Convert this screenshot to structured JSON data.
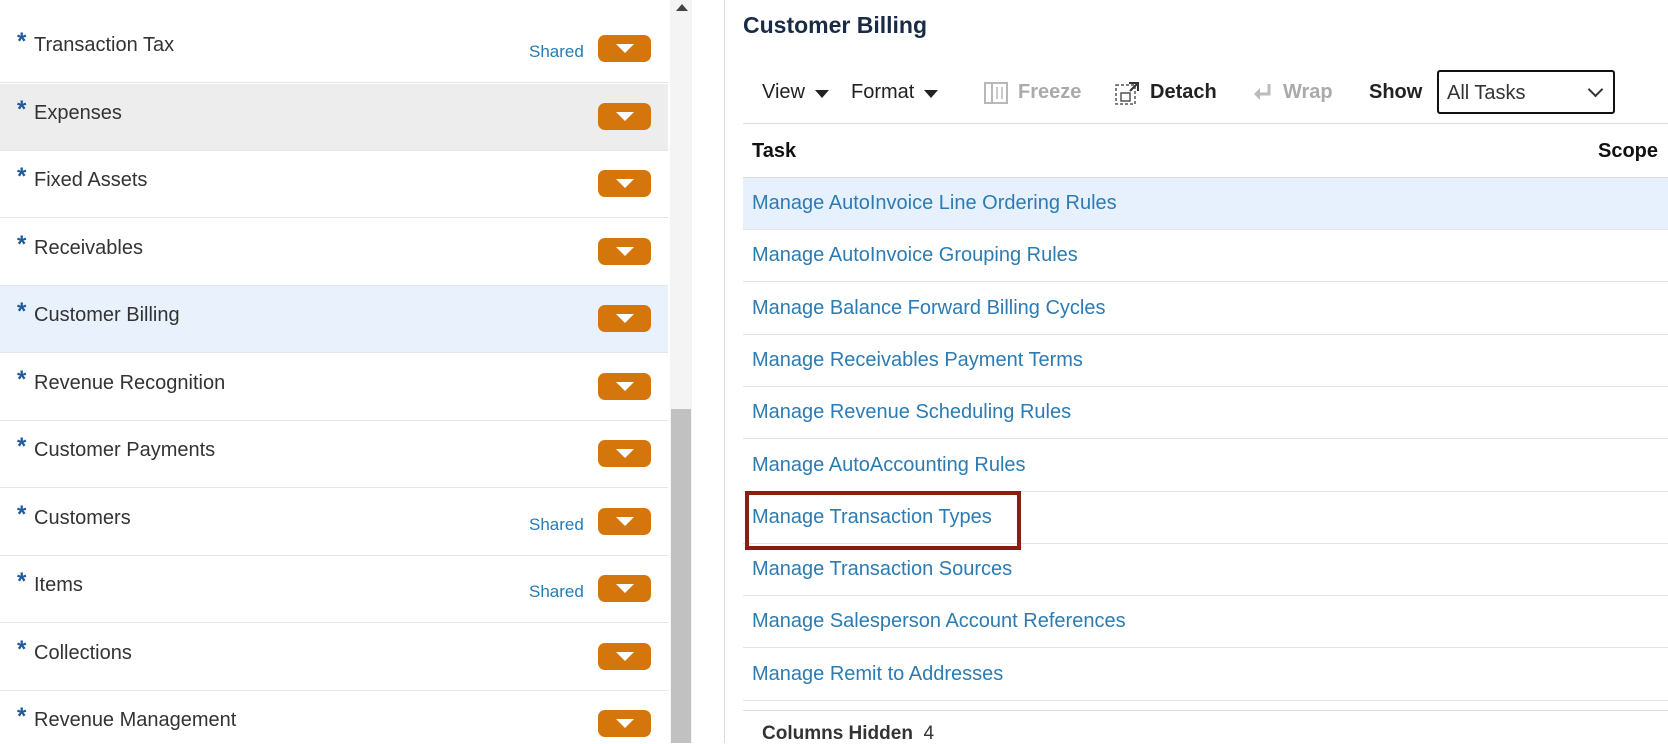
{
  "left_panel": {
    "items": [
      {
        "label": "Transaction Tax",
        "shared": "Shared",
        "state": ""
      },
      {
        "label": "Expenses",
        "shared": "",
        "state": "hover"
      },
      {
        "label": "Fixed Assets",
        "shared": "",
        "state": ""
      },
      {
        "label": "Receivables",
        "shared": "",
        "state": ""
      },
      {
        "label": "Customer Billing",
        "shared": "",
        "state": "selected"
      },
      {
        "label": "Revenue Recognition",
        "shared": "",
        "state": ""
      },
      {
        "label": "Customer Payments",
        "shared": "",
        "state": ""
      },
      {
        "label": "Customers",
        "shared": "Shared",
        "state": ""
      },
      {
        "label": "Items",
        "shared": "Shared",
        "state": ""
      },
      {
        "label": "Collections",
        "shared": "",
        "state": ""
      },
      {
        "label": "Revenue Management",
        "shared": "",
        "state": ""
      }
    ],
    "required_marker": "*"
  },
  "main": {
    "title": "Customer Billing",
    "toolbar": {
      "view_label": "View",
      "format_label": "Format",
      "freeze_label": "Freeze",
      "detach_label": "Detach",
      "wrap_label": "Wrap",
      "show_label": "Show",
      "show_value": "All Tasks"
    },
    "table": {
      "headers": {
        "task": "Task",
        "scope": "Scope"
      },
      "rows": [
        {
          "task": "Manage AutoInvoice Line Ordering Rules",
          "selected": true
        },
        {
          "task": "Manage AutoInvoice Grouping Rules",
          "selected": false
        },
        {
          "task": "Manage Balance Forward Billing Cycles",
          "selected": false
        },
        {
          "task": "Manage Receivables Payment Terms",
          "selected": false
        },
        {
          "task": "Manage Revenue Scheduling Rules",
          "selected": false
        },
        {
          "task": "Manage AutoAccounting Rules",
          "selected": false
        },
        {
          "task": "Manage Transaction Types",
          "selected": false,
          "highlighted": true
        },
        {
          "task": "Manage Transaction Sources",
          "selected": false
        },
        {
          "task": "Manage Salesperson Account References",
          "selected": false
        },
        {
          "task": "Manage Remit to Addresses",
          "selected": false
        }
      ]
    },
    "footer": {
      "columns_hidden_label": "Columns Hidden",
      "columns_hidden_count": "4"
    }
  },
  "colors": {
    "accent_orange": "#d4760c",
    "link_blue": "#2c7bb2",
    "highlight_red": "#8a1e12",
    "selected_row": "#e6f1fd"
  }
}
